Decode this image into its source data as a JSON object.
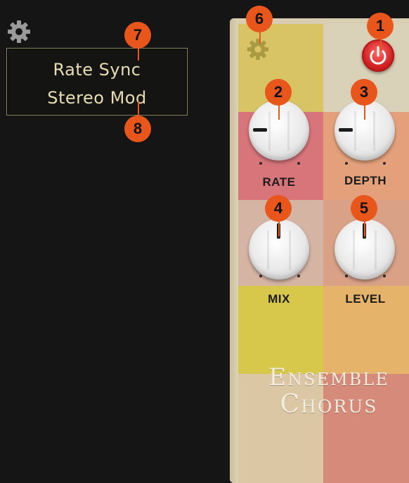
{
  "menu": {
    "items": [
      "Rate Sync",
      "Stereo Mod"
    ]
  },
  "pedal": {
    "knob_labels": {
      "rate": "RATE",
      "depth": "DEPTH",
      "mix": "MIX",
      "level": "LEVEL"
    },
    "brand_line1": "Ensemble",
    "brand_line2": "Chorus",
    "colors": {
      "power": "#d01f1f",
      "badge": "#e8561c"
    }
  },
  "callouts": [
    "1",
    "2",
    "3",
    "4",
    "5",
    "6",
    "7",
    "8"
  ],
  "icons": {
    "settings": "gear-icon",
    "power": "power-icon"
  }
}
